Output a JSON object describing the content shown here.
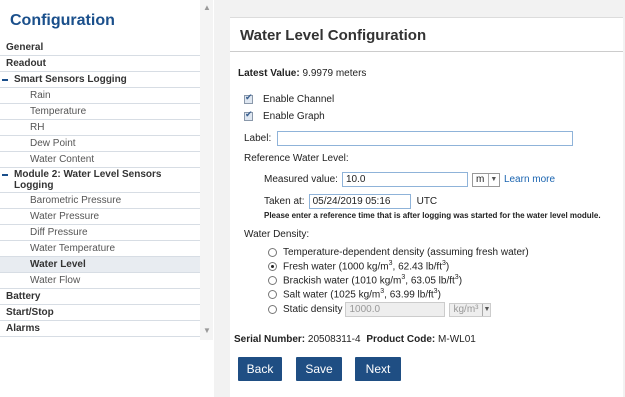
{
  "sidebar": {
    "title": "Configuration",
    "items": [
      {
        "label": "General",
        "kind": "top"
      },
      {
        "label": "Readout",
        "kind": "top"
      },
      {
        "label": "Smart Sensors Logging",
        "kind": "top-expanded"
      },
      {
        "label": "Rain",
        "kind": "sub"
      },
      {
        "label": "Temperature",
        "kind": "sub"
      },
      {
        "label": "RH",
        "kind": "sub"
      },
      {
        "label": "Dew Point",
        "kind": "sub"
      },
      {
        "label": "Water Content",
        "kind": "sub"
      },
      {
        "label": "Module 2: Water Level Sensors Logging",
        "kind": "module"
      },
      {
        "label": "Barometric Pressure",
        "kind": "sub"
      },
      {
        "label": "Water Pressure",
        "kind": "sub"
      },
      {
        "label": "Diff Pressure",
        "kind": "sub"
      },
      {
        "label": "Water Temperature",
        "kind": "sub"
      },
      {
        "label": "Water Level",
        "kind": "sub-active"
      },
      {
        "label": "Water Flow",
        "kind": "sub"
      },
      {
        "label": "Battery",
        "kind": "top"
      },
      {
        "label": "Start/Stop",
        "kind": "top"
      },
      {
        "label": "Alarms",
        "kind": "top"
      }
    ]
  },
  "main": {
    "heading": "Water Level Configuration",
    "latest_label": "Latest Value:",
    "latest_value": "9.9979 meters",
    "enable_channel": "Enable Channel",
    "enable_graph": "Enable Graph",
    "label_caption": "Label:",
    "label_value": "",
    "ref_level_caption": "Reference Water Level:",
    "measured_caption": "Measured value:",
    "measured_value": "10.0",
    "unit_value": "m",
    "learn_more": "Learn more",
    "taken_caption": "Taken at:",
    "taken_value": "05/24/2019 05:16",
    "utc": "UTC",
    "note": "Please enter a reference time that is after logging was started for the water level module.",
    "density_caption": "Water Density:",
    "density_options": [
      {
        "pre": "Temperature-dependent density (assuming fresh water)",
        "selected": false
      },
      {
        "pre": "Fresh water (1000 kg/m",
        "mid": ", 62.43 lb/ft",
        "post": ")",
        "selected": true
      },
      {
        "pre": "Brackish water (1010 kg/m",
        "mid": ", 63.05 lb/ft",
        "post": ")",
        "selected": false
      },
      {
        "pre": "Salt water (1025 kg/m",
        "mid": ", 63.99 lb/ft",
        "post": ")",
        "selected": false
      }
    ],
    "static_caption": "Static density",
    "static_value": "1000.0",
    "static_unit": "kg/m³",
    "sup3": "3",
    "serial_label": "Serial Number:",
    "serial_value": "20508311-4",
    "product_label": "Product Code:",
    "product_value": "M-WL01",
    "buttons": {
      "back": "Back",
      "save": "Save",
      "next": "Next"
    }
  },
  "colors": {
    "accent": "#1f4e83",
    "title": "#1a4f8b",
    "link": "#1a64b0"
  }
}
